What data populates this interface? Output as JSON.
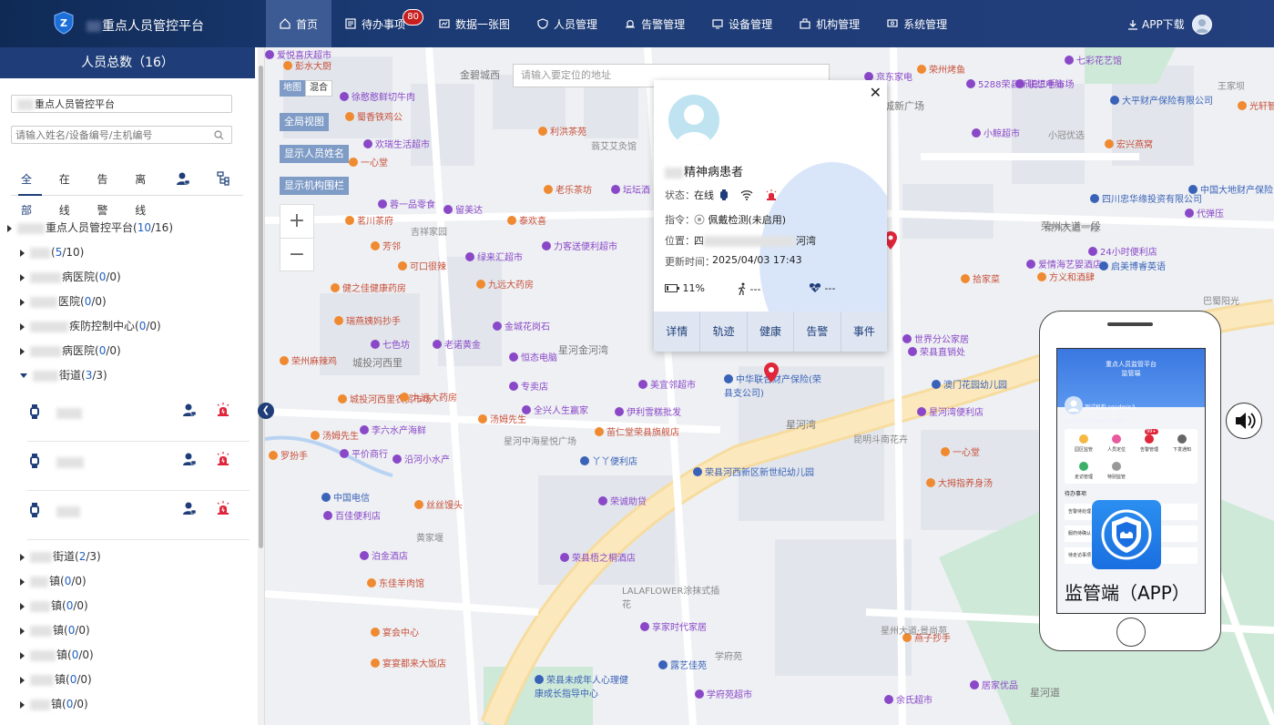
{
  "header": {
    "app_title": "重点人员管控平台",
    "nav": [
      {
        "label": "首页",
        "icon": "home-icon",
        "active": true
      },
      {
        "label": "待办事项",
        "icon": "todo-icon",
        "badge": "80"
      },
      {
        "label": "数据一张图",
        "icon": "data-map-icon"
      },
      {
        "label": "人员管理",
        "icon": "person-shield-icon"
      },
      {
        "label": "告警管理",
        "icon": "alarm-icon"
      },
      {
        "label": "设备管理",
        "icon": "device-icon"
      },
      {
        "label": "机构管理",
        "icon": "org-icon"
      },
      {
        "label": "系统管理",
        "icon": "system-icon"
      }
    ],
    "app_download": "APP下载"
  },
  "sidebar": {
    "title": "人员总数（16）",
    "org_select": "重点人员管控平台",
    "search_placeholder": "请输入姓名/设备编号/主机编号",
    "tabs": [
      "全部",
      "在线",
      "告警",
      "离线"
    ],
    "tree": {
      "root": {
        "label": "重点人员管控平台",
        "count": "10",
        "total": "16"
      },
      "nodes": [
        {
          "label": "",
          "count": "5",
          "total": "10"
        },
        {
          "label": "病医院",
          "count": "0",
          "total": "0"
        },
        {
          "label": "医院",
          "count": "0",
          "total": "0"
        },
        {
          "label": "疾防控制中心",
          "count": "0",
          "total": "0"
        },
        {
          "label": "病医院",
          "count": "0",
          "total": "0"
        },
        {
          "label": "街道",
          "count": "3",
          "total": "3",
          "expanded": true
        },
        {
          "label": "街道",
          "count": "2",
          "total": "3"
        },
        {
          "label": "镇",
          "count": "0",
          "total": "0"
        },
        {
          "label": "镇",
          "count": "0",
          "total": "0"
        },
        {
          "label": "镇",
          "count": "0",
          "total": "0"
        },
        {
          "label": "镇",
          "count": "0",
          "total": "0"
        },
        {
          "label": "镇",
          "count": "0",
          "total": "0"
        },
        {
          "label": "镇",
          "count": "0",
          "total": "0"
        }
      ]
    }
  },
  "map": {
    "search_placeholder": "请输入要定位的地址",
    "type_map": "地图",
    "type_hybrid": "混合",
    "btn_full": "全局视图",
    "btn_show_names": "显示人员姓名",
    "btn_show_org": "显示机构围栏",
    "zoom_in": "+",
    "zoom_out": "−",
    "pois": [
      {
        "t": "彭水大厨",
        "c": ""
      },
      {
        "t": "徐憨憨鲜切牛肉",
        "c": "p"
      },
      {
        "t": "蜀香铁鸡公",
        "c": ""
      },
      {
        "t": "欢瑞生活超市",
        "c": "p"
      },
      {
        "t": "一心堂",
        "c": ""
      },
      {
        "t": "蓉一品零食",
        "c": "p"
      },
      {
        "t": "茗川茶府",
        "c": ""
      },
      {
        "t": "芳邻",
        "c": ""
      },
      {
        "t": "健之佳健康药房",
        "c": ""
      },
      {
        "t": "瑞燕姨妈抄手",
        "c": ""
      },
      {
        "t": "七色坊",
        "c": "p"
      },
      {
        "t": "荣州麻辣鸡",
        "c": ""
      },
      {
        "t": "城投河西里农贸市场",
        "c": ""
      },
      {
        "t": "李六水产海鲜",
        "c": "p"
      },
      {
        "t": "平价商行",
        "c": "p"
      },
      {
        "t": "中国电信",
        "c": "b"
      },
      {
        "t": "百佳便利店",
        "c": "p"
      },
      {
        "t": "泊金酒店",
        "c": "p"
      },
      {
        "t": "东佳羊肉馆",
        "c": ""
      },
      {
        "t": "宴会中心",
        "c": ""
      },
      {
        "t": "宴宴都来大饭店",
        "c": ""
      },
      {
        "t": "荣县未成年人心理健康成长指导中心",
        "c": "b"
      },
      {
        "t": "荣县梧之桐酒店",
        "c": "p"
      },
      {
        "t": "LALAFLOWER涂抹式插花",
        "c": "gr"
      },
      {
        "t": "享家时代家居",
        "c": "p"
      },
      {
        "t": "露艺佳苑",
        "c": "b"
      },
      {
        "t": "学府苑",
        "c": "gr"
      },
      {
        "t": "学府苑超市",
        "c": "p"
      },
      {
        "t": "荣县河西新区新世纪幼儿园",
        "c": "b"
      },
      {
        "t": "荣诚助贷",
        "c": "p"
      },
      {
        "t": "丫丫便利店",
        "c": "b"
      },
      {
        "t": "苗仁堂荣县旗舰店",
        "c": ""
      },
      {
        "t": "伊利雪糕批发",
        "c": "p"
      },
      {
        "t": "全兴人生赢家",
        "c": "p"
      },
      {
        "t": "汤姆先生",
        "c": ""
      },
      {
        "t": "九远大药房",
        "c": ""
      },
      {
        "t": "老诺黄金",
        "c": "p"
      },
      {
        "t": "金城花岗石",
        "c": "p"
      },
      {
        "t": "恒态电脑",
        "c": "p"
      },
      {
        "t": "专卖店",
        "c": "p"
      },
      {
        "t": "美宜邻超市",
        "c": "p"
      },
      {
        "t": "中华联合财产保险(荣县支公司)",
        "c": "b"
      },
      {
        "t": "九远大药房",
        "c": ""
      },
      {
        "t": "力客送便利超市",
        "c": "p"
      },
      {
        "t": "绿来汇超市",
        "c": "p"
      },
      {
        "t": "吉祥家园",
        "c": "gr"
      },
      {
        "t": "可口很辣",
        "c": ""
      },
      {
        "t": "泰欢喜",
        "c": ""
      },
      {
        "t": "留美达",
        "c": "p"
      },
      {
        "t": "老乐茶坊",
        "c": ""
      },
      {
        "t": "坛坛酒",
        "c": "p"
      },
      {
        "t": "利洪茶苑",
        "c": ""
      },
      {
        "t": "蓊艾艾灸馆",
        "c": "gr"
      },
      {
        "t": "荣州烤鱼",
        "c": ""
      },
      {
        "t": "京东家电",
        "c": "p"
      },
      {
        "t": "5288荣县新旧二手市场",
        "c": "p"
      },
      {
        "t": "联想电脑",
        "c": "p"
      },
      {
        "t": "七彩花艺馆",
        "c": "p"
      },
      {
        "t": "大平财产保险有限公司",
        "c": "b"
      },
      {
        "t": "王家坝",
        "c": "gr"
      },
      {
        "t": "光轩智慧厨",
        "c": ""
      },
      {
        "t": "小鲸超市",
        "c": "p"
      },
      {
        "t": "小冠优选",
        "c": "gr"
      },
      {
        "t": "宏兴燕窝",
        "c": ""
      },
      {
        "t": "中国大地财产保险",
        "c": "b"
      },
      {
        "t": "四川忠华缘投资有限公司",
        "c": "b"
      },
      {
        "t": "代弹压",
        "c": "p"
      },
      {
        "t": "荣州大道一段",
        "c": "gr"
      },
      {
        "t": "24小时便利店",
        "c": "p"
      },
      {
        "t": "爱情海艺婴酒店",
        "c": "p"
      },
      {
        "t": "启美博睿英语",
        "c": "b"
      },
      {
        "t": "方义和酒肆",
        "c": ""
      },
      {
        "t": "巴蜀阳光",
        "c": "gr"
      },
      {
        "t": "拾家菜",
        "c": ""
      },
      {
        "t": "世界分公家居",
        "c": "p"
      },
      {
        "t": "荣县直销处",
        "c": "p"
      },
      {
        "t": "澳门花园幼儿园",
        "c": "b"
      },
      {
        "t": "星河湾便利店",
        "c": "p"
      },
      {
        "t": "昆明斗南花卉",
        "c": "gr"
      },
      {
        "t": "一心堂",
        "c": ""
      },
      {
        "t": "大拇指养身汤",
        "c": ""
      },
      {
        "t": "荣州烟酒",
        "c": "p"
      },
      {
        "t": "燕子抄手",
        "c": ""
      },
      {
        "t": "居家优品",
        "c": "p"
      },
      {
        "t": "余氏超市",
        "c": "p"
      },
      {
        "t": "星州大道·景尚苑",
        "c": "gr"
      },
      {
        "t": "罗扮手",
        "c": ""
      },
      {
        "t": "丝丝馒头",
        "c": ""
      },
      {
        "t": "汤姆先生",
        "c": ""
      },
      {
        "t": "沿河小水产",
        "c": "p"
      },
      {
        "t": "星河中海星悦广场",
        "c": "gr"
      },
      {
        "t": "黄家堰",
        "c": "gr"
      },
      {
        "t": "爱悦喜庆超市",
        "c": "p"
      }
    ],
    "roads": [
      "城投河西里",
      "星河金河湾",
      "星河湾",
      "金碧城西",
      "荣州大道一段",
      "星河道",
      "城新广场"
    ]
  },
  "popup": {
    "name": "精神病患者",
    "status_label": "状态：",
    "status_value": "在线",
    "command_label": "指令：",
    "command_value": "佩戴检测(未启用)",
    "location_label": "位置：",
    "location_value_prefix": "四",
    "location_value_suffix": "河湾",
    "update_label": "更新时间：",
    "update_value": "2025/04/03 17:43",
    "battery": "11%",
    "steps": "---",
    "heart": "---",
    "actions": [
      "详情",
      "轨迹",
      "健康",
      "告警",
      "事件"
    ]
  },
  "phone": {
    "header_title": "重点人员监管平台",
    "header_sub": "监管端",
    "user_line": "测试机构  sqadmin3",
    "date_line": "2025-01-07 16:08:35 星期二",
    "grid_labels": [
      "园区监管",
      "人员定位",
      "告警管理",
      "下发通知",
      "走访管理",
      "特别监管"
    ],
    "todo_label": "待办事项",
    "list_items": [
      "告警待处理",
      "服药待确认",
      "待走访事项"
    ],
    "caption": "监管端（APP）",
    "grid_badge": "99+"
  }
}
